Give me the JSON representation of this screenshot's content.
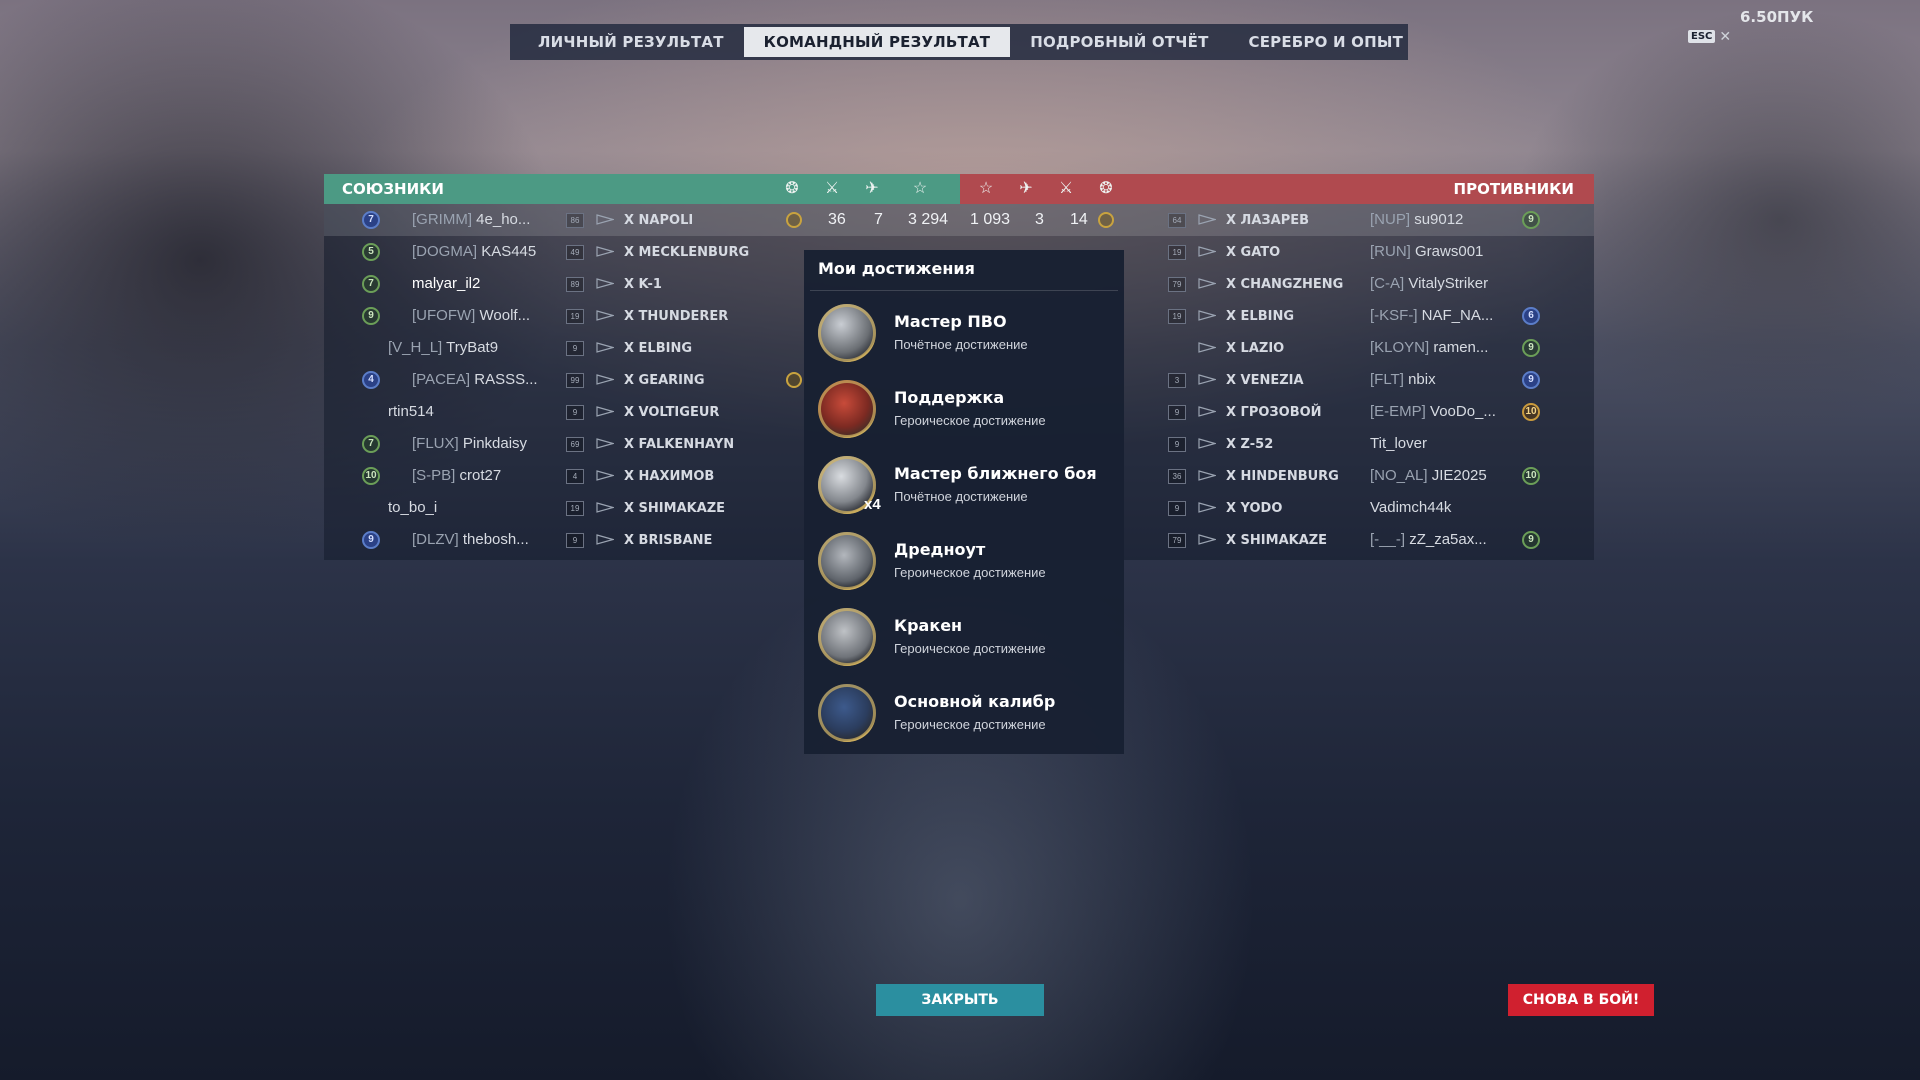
{
  "tabs": [
    "ЛИЧНЫЙ РЕЗУЛЬТАТ",
    "КОМАНДНЫЙ РЕЗУЛЬТАТ",
    "ПОДРОБНЫЙ ОТЧЁТ",
    "СЕРЕБРО И ОПЫТ"
  ],
  "active_tab": "КОМАНДНЫЙ РЕЗУЛЬТАТ",
  "esc_label": "ESC",
  "top_right_text": "6.50ПУК",
  "allies_label": "СОЮЗНИКИ",
  "enemies_label": "ПРОТИВНИКИ",
  "header_icons": [
    "wreath-icon",
    "crossed-swords-icon",
    "plane-icon",
    "star-icon"
  ],
  "allies": [
    {
      "rank": "7",
      "rank_style": "blue",
      "clan": "[GRIMM]",
      "name": "4e_ho...",
      "level": "86",
      "ship": "X NAPOLI",
      "medal": true,
      "kills": "36",
      "planes": "7",
      "xp": "3 294",
      "highlight": true
    },
    {
      "rank": "5",
      "rank_style": "green",
      "clan": "[DOGMA]",
      "name": "KAS445",
      "level": "49",
      "ship": "X MECKLENBURG"
    },
    {
      "rank": "7",
      "rank_style": "green",
      "clan": "",
      "name": "malyar_il2",
      "level": "89",
      "ship": "X K-1",
      "me": true
    },
    {
      "rank": "9",
      "rank_style": "green",
      "clan": "[UFOFW]",
      "name": "Woolf...",
      "level": "19",
      "ship": "X THUNDERER"
    },
    {
      "rank": "",
      "clan": "[V_H_L]",
      "name": "TryBat9",
      "level": "9",
      "ship": "X ELBING"
    },
    {
      "rank": "4",
      "rank_style": "blue",
      "clan": "[PACEA]",
      "name": "RASSS...",
      "level": "99",
      "ship": "X GEARING",
      "medal": true
    },
    {
      "rank": "",
      "clan": "",
      "name": "rtin514",
      "level": "9",
      "ship": "X VOLTIGEUR"
    },
    {
      "rank": "7",
      "rank_style": "green",
      "clan": "[FLUX]",
      "name": "Pinkdaisy",
      "level": "69",
      "ship": "X FALKENHAYN"
    },
    {
      "rank": "10",
      "rank_style": "green",
      "clan": "[S-PB]",
      "name": "crot27",
      "level": "4",
      "ship": "X НАХИМОВ"
    },
    {
      "rank": "",
      "clan": "",
      "name": "to_bo_i",
      "level": "19",
      "ship": "X SHIMAKAZE"
    },
    {
      "rank": "9",
      "rank_style": "blue",
      "clan": "[DLZV]",
      "name": "thebosh...",
      "level": "9",
      "ship": "X BRISBANE"
    }
  ],
  "enemies": [
    {
      "xp": "1 093",
      "planes": "3",
      "kills": "14",
      "medal": true,
      "level": "64",
      "ship": "X ЛАЗАРЕВ",
      "clan": "[NUP]",
      "name": "su9012",
      "rank": "9",
      "rank_style": "green"
    },
    {
      "level": "19",
      "ship": "X GATO",
      "clan": "[RUN]",
      "name": "Graws001",
      "rank": ""
    },
    {
      "level": "79",
      "ship": "X CHANGZHENG",
      "clan": "[C-A]",
      "name": "VitalyStriker",
      "rank": ""
    },
    {
      "level": "19",
      "ship": "X ELBING",
      "clan": "[-KSF-]",
      "name": "NAF_NA...",
      "rank": "6",
      "rank_style": "blue"
    },
    {
      "level": "",
      "ship": "X LAZIO",
      "clan": "[KLOYN]",
      "name": "ramen...",
      "rank": "9",
      "rank_style": "green"
    },
    {
      "level": "3",
      "ship": "X VENEZIA",
      "clan": "[FLT]",
      "name": "nbix",
      "rank": "9",
      "rank_style": "blue"
    },
    {
      "level": "9",
      "ship": "X ГРОЗОВОЙ",
      "clan": "[E-EMP]",
      "name": "VooDo_...",
      "rank": "10",
      "rank_style": "gold"
    },
    {
      "level": "9",
      "ship": "X Z-52",
      "clan": "",
      "name": "Tit_lover",
      "rank": ""
    },
    {
      "level": "36",
      "ship": "X HINDENBURG",
      "clan": "[NO_AL]",
      "name": "JIE2025",
      "rank": "10",
      "rank_style": "green"
    },
    {
      "level": "9",
      "ship": "X YODO",
      "clan": "",
      "name": "Vadimch44k",
      "rank": ""
    },
    {
      "level": "79",
      "ship": "X SHIMAKAZE",
      "clan": "[-__-]",
      "name": "zZ_za5ax...",
      "rank": "9",
      "rank_style": "green"
    }
  ],
  "achievements_title": "Мои достижения",
  "achievements": [
    {
      "name": "Мастер ПВО",
      "type": "Почётное достижение",
      "icon": "aa-gun-medal-icon",
      "count": ""
    },
    {
      "name": "Поддержка",
      "type": "Героическое достижение",
      "icon": "support-shield-medal-icon",
      "count": ""
    },
    {
      "name": "Мастер ближнего боя",
      "type": "Почётное достижение",
      "icon": "secondary-battery-medal-icon",
      "count": "x4"
    },
    {
      "name": "Дредноут",
      "type": "Героическое достижение",
      "icon": "dreadnought-medal-icon",
      "count": ""
    },
    {
      "name": "Кракен",
      "type": "Героическое достижение",
      "icon": "kraken-medal-icon",
      "count": ""
    },
    {
      "name": "Основной калибр",
      "type": "Героическое достижение",
      "icon": "main-caliber-medal-icon",
      "count": ""
    }
  ],
  "buttons": {
    "close": "ЗАКРЫТЬ",
    "battle_again": "СНОВА В БОЙ!"
  },
  "colors": {
    "ally_header": "#4c9a84",
    "enemy_header": "#b04a4f",
    "close_button": "#2b8fa0",
    "battle_button": "#d0202f",
    "popup_bg": "#182032"
  }
}
